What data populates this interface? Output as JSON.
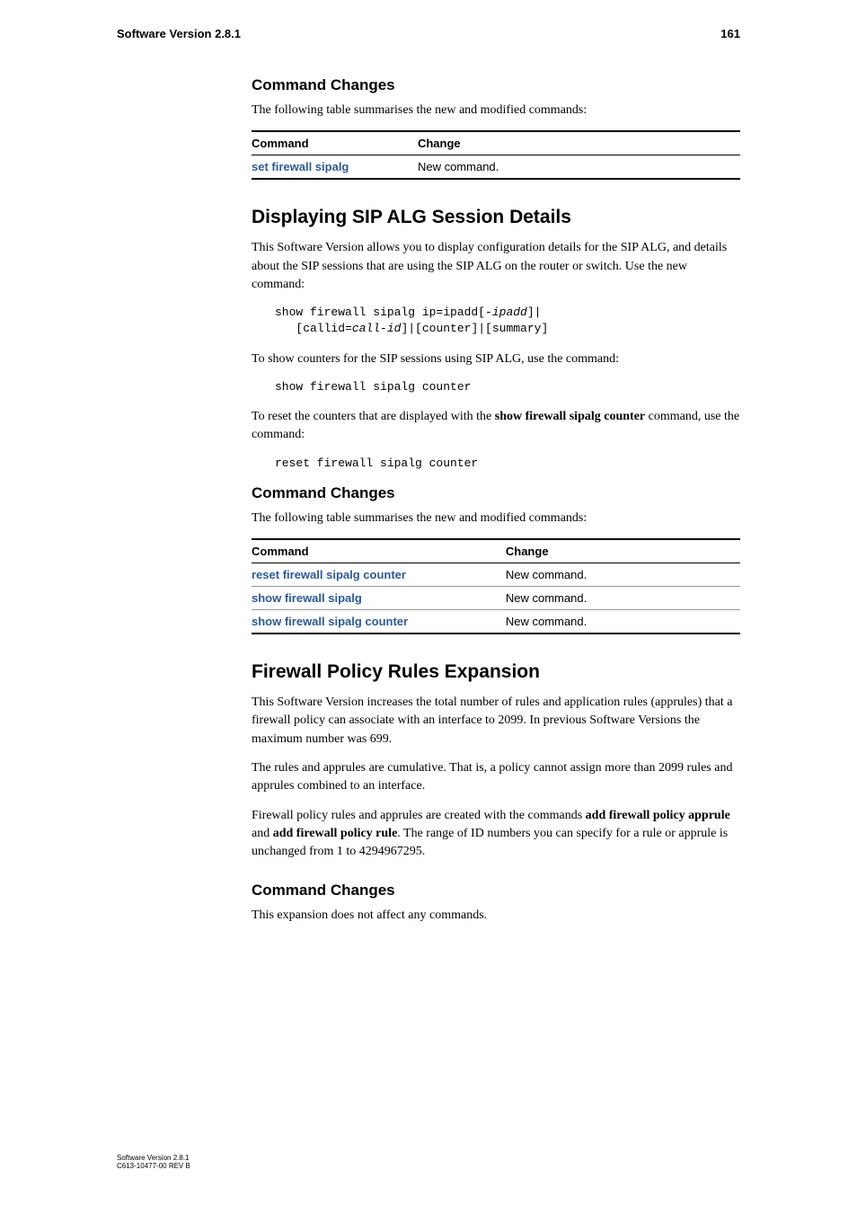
{
  "header": {
    "left": "Software Version 2.8.1",
    "right": "161"
  },
  "section1": {
    "title": "Command Changes",
    "intro": "The following table summarises the new and modified commands:",
    "table": {
      "head": {
        "c1": "Command",
        "c2": "Change"
      },
      "rows": [
        {
          "cmd": "set firewall sipalg",
          "change": "New command."
        }
      ]
    }
  },
  "section2": {
    "title": "Displaying SIP ALG Session Details",
    "p1": "This Software Version allows you to display configuration details for the SIP ALG, and details about the SIP sessions that are using the SIP ALG on the router or switch. Use the new command:",
    "code1_line1": "show firewall sipalg ip=ipadd[-",
    "code1_ipadd": "ipadd",
    "code1_line1_end": "]|",
    "code1_line2_start": "   [callid=",
    "code1_callid": "call-id",
    "code1_line2_end": "]|[counter]|[summary]",
    "p2": "To show counters for the SIP sessions using SIP ALG, use the command:",
    "code2": "show firewall sipalg counter",
    "p3_before": "To reset the counters that are displayed with the ",
    "p3_bold": "show firewall sipalg counter",
    "p3_after": " command, use the command:",
    "code3": "reset firewall sipalg counter"
  },
  "section3": {
    "title": "Command Changes",
    "intro": "The following table summarises the new and modified commands:",
    "table": {
      "head": {
        "c1": "Command",
        "c2": "Change"
      },
      "rows": [
        {
          "cmd": "reset firewall sipalg counter",
          "change": "New command."
        },
        {
          "cmd": "show firewall sipalg",
          "change": "New command."
        },
        {
          "cmd": "show firewall sipalg counter",
          "change": "New command."
        }
      ]
    }
  },
  "section4": {
    "title": "Firewall Policy Rules Expansion",
    "p1": "This Software Version increases the total number of rules and application rules (apprules) that a firewall policy can associate with an interface to 2099. In previous Software Versions the maximum number was 699.",
    "p2": "The rules and apprules are cumulative. That is, a policy cannot assign more than 2099 rules and apprules combined to an interface.",
    "p3_before": "Firewall policy rules and apprules are created with the commands ",
    "p3_b1": "add firewall policy apprule",
    "p3_mid": " and ",
    "p3_b2": "add firewall policy rule",
    "p3_after": ". The range of ID numbers you can specify for a rule or apprule is unchanged from 1 to 4294967295.",
    "sub_title": "Command Changes",
    "p4": "This expansion does not affect any commands."
  },
  "footer": {
    "line1": "Software Version 2.8.1",
    "line2": "C613-10477-00 REV B"
  }
}
